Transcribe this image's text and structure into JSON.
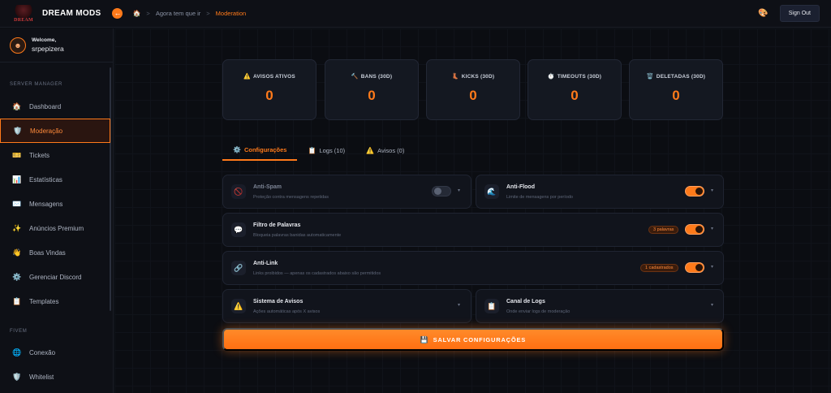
{
  "header": {
    "brand": "DREAM MODS",
    "logo_text": "DREAM",
    "back_icon": "arrow-left-icon",
    "breadcrumb": {
      "home_icon": "🏠",
      "sep": ">",
      "items": [
        "Agora tem que ir",
        "Moderation"
      ]
    },
    "sign_out": "Sign Out",
    "palette_icon": "🎨"
  },
  "sidebar": {
    "welcome": "Welcome,",
    "username": "srpepizera",
    "sections": [
      {
        "label": "SERVER MANAGER",
        "items": [
          {
            "icon": "🏠",
            "label": "Dashboard"
          },
          {
            "icon": "🛡️",
            "label": "Moderação",
            "active": true
          },
          {
            "icon": "🎫",
            "label": "Tickets"
          },
          {
            "icon": "📊",
            "label": "Estatísticas"
          },
          {
            "icon": "✉️",
            "label": "Mensagens"
          },
          {
            "icon": "✨",
            "label": "Anúncios Premium"
          },
          {
            "icon": "👋",
            "label": "Boas Vindas"
          },
          {
            "icon": "⚙️",
            "label": "Gerenciar Discord"
          },
          {
            "icon": "📋",
            "label": "Templates"
          }
        ]
      },
      {
        "label": "FIVEM",
        "items": [
          {
            "icon": "🌐",
            "label": "Conexão"
          },
          {
            "icon": "🛡️",
            "label": "Whitelist"
          }
        ]
      }
    ]
  },
  "stats": [
    {
      "icon": "⚠️",
      "label": "AVISOS ATIVOS",
      "value": "0"
    },
    {
      "icon": "🔨",
      "label": "BANS (30D)",
      "value": "0"
    },
    {
      "icon": "👢",
      "label": "KICKS (30D)",
      "value": "0"
    },
    {
      "icon": "⏱️",
      "label": "TIMEOUTS (30D)",
      "value": "0"
    },
    {
      "icon": "🗑️",
      "label": "DELETADAS (30D)",
      "value": "0"
    }
  ],
  "tabs": [
    {
      "icon": "⚙️",
      "label": "Configurações",
      "active": true
    },
    {
      "icon": "📋",
      "label": "Logs (10)"
    },
    {
      "icon": "⚠️",
      "label": "Avisos (0)"
    }
  ],
  "panels": {
    "antispam": {
      "icon": "🚫",
      "title": "Anti-Spam",
      "desc": "Proteção contra mensagens repetidas",
      "enabled": false
    },
    "antiflood": {
      "icon": "🌊",
      "title": "Anti-Flood",
      "desc": "Limite de mensagens por período",
      "enabled": true
    },
    "filtro": {
      "icon": "💬",
      "title": "Filtro de Palavras",
      "desc": "Bloqueia palavras banidas automaticamente",
      "badge": "3 palavras",
      "enabled": true
    },
    "antilink": {
      "icon": "🔗",
      "title": "Anti-Link",
      "desc": "Links proibidos — apenas os cadastrados abaixo são permitidos",
      "badge": "1 cadastrados",
      "enabled": true
    },
    "avisos": {
      "icon": "⚠️",
      "title": "Sistema de Avisos",
      "desc": "Ações automáticas após X avisos"
    },
    "logs": {
      "icon": "📋",
      "title": "Canal de Logs",
      "desc": "Onde enviar logs de moderação"
    }
  },
  "caret": "▾",
  "save_button": {
    "icon": "💾",
    "label": "SALVAR CONFIGURAÇÕES"
  },
  "colors": {
    "accent": "#ff7a1a",
    "background": "#0b0d12",
    "card": "#141821"
  }
}
